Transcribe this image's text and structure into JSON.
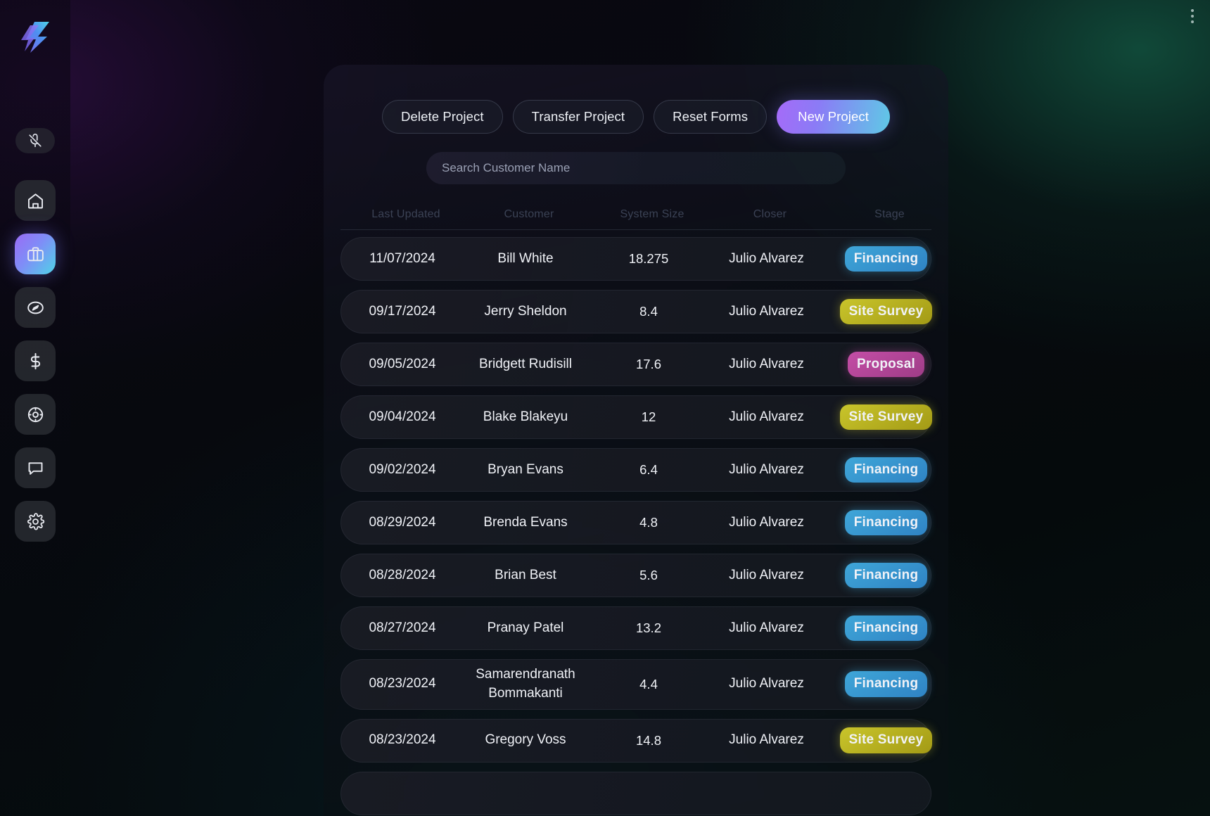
{
  "sidebar": {
    "logo_name": "app-logo",
    "mute": {
      "icon": "microphone-off-icon"
    },
    "items": [
      {
        "icon": "home-icon",
        "name": "home",
        "active": false
      },
      {
        "icon": "briefcase-icon",
        "name": "projects",
        "active": true
      },
      {
        "icon": "compass-icon",
        "name": "explore",
        "active": false
      },
      {
        "icon": "dollar-icon",
        "name": "finance",
        "active": false
      },
      {
        "icon": "target-icon",
        "name": "targets",
        "active": false
      },
      {
        "icon": "chat-bubble-icon",
        "name": "messages",
        "active": false
      },
      {
        "icon": "gear-icon",
        "name": "settings",
        "active": false
      }
    ]
  },
  "topbar": {
    "kebab_icon": "more-vertical-icon"
  },
  "toolbar": {
    "delete_label": "Delete Project",
    "transfer_label": "Transfer Project",
    "reset_label": "Reset Forms",
    "new_label": "New Project"
  },
  "search": {
    "placeholder": "Search Customer Name",
    "value": ""
  },
  "table": {
    "headers": {
      "last_updated": "Last Updated",
      "customer": "Customer",
      "system_size": "System Size",
      "closer": "Closer",
      "stage": "Stage"
    },
    "rows": [
      {
        "last_updated": "11/07/2024",
        "customer": "Bill White",
        "system_size": "18.275",
        "closer": "Julio Alvarez",
        "stage": "Financing",
        "stage_class": "badge-financing"
      },
      {
        "last_updated": "09/17/2024",
        "customer": "Jerry Sheldon",
        "system_size": "8.4",
        "closer": "Julio Alvarez",
        "stage": "Site Survey",
        "stage_class": "badge-site-survey"
      },
      {
        "last_updated": "09/05/2024",
        "customer": "Bridgett Rudisill",
        "system_size": "17.6",
        "closer": "Julio Alvarez",
        "stage": "Proposal",
        "stage_class": "badge-proposal"
      },
      {
        "last_updated": "09/04/2024",
        "customer": "Blake Blakeyu",
        "system_size": "12",
        "closer": "Julio Alvarez",
        "stage": "Site Survey",
        "stage_class": "badge-site-survey"
      },
      {
        "last_updated": "09/02/2024",
        "customer": "Bryan Evans",
        "system_size": "6.4",
        "closer": "Julio Alvarez",
        "stage": "Financing",
        "stage_class": "badge-financing"
      },
      {
        "last_updated": "08/29/2024",
        "customer": "Brenda Evans",
        "system_size": "4.8",
        "closer": "Julio Alvarez",
        "stage": "Financing",
        "stage_class": "badge-financing"
      },
      {
        "last_updated": "08/28/2024",
        "customer": "Brian Best",
        "system_size": "5.6",
        "closer": "Julio Alvarez",
        "stage": "Financing",
        "stage_class": "badge-financing"
      },
      {
        "last_updated": "08/27/2024",
        "customer": "Pranay Patel",
        "system_size": "13.2",
        "closer": "Julio Alvarez",
        "stage": "Financing",
        "stage_class": "badge-financing"
      },
      {
        "last_updated": "08/23/2024",
        "customer": "Samarendranath Bommakanti",
        "system_size": "4.4",
        "closer": "Julio Alvarez",
        "stage": "Financing",
        "stage_class": "badge-financing"
      },
      {
        "last_updated": "08/23/2024",
        "customer": "Gregory Voss",
        "system_size": "14.8",
        "closer": "Julio Alvarez",
        "stage": "Site Survey",
        "stage_class": "badge-site-survey"
      },
      {
        "last_updated": "",
        "customer": "",
        "system_size": "",
        "closer": "",
        "stage": "",
        "stage_class": "badge-proposal"
      }
    ]
  },
  "colors": {
    "accent_purple": "#a56bf8",
    "accent_cyan": "#5fc9e6",
    "financing": "#3fa6d8",
    "site_survey": "#c9c52b",
    "proposal": "#c44ea6"
  }
}
